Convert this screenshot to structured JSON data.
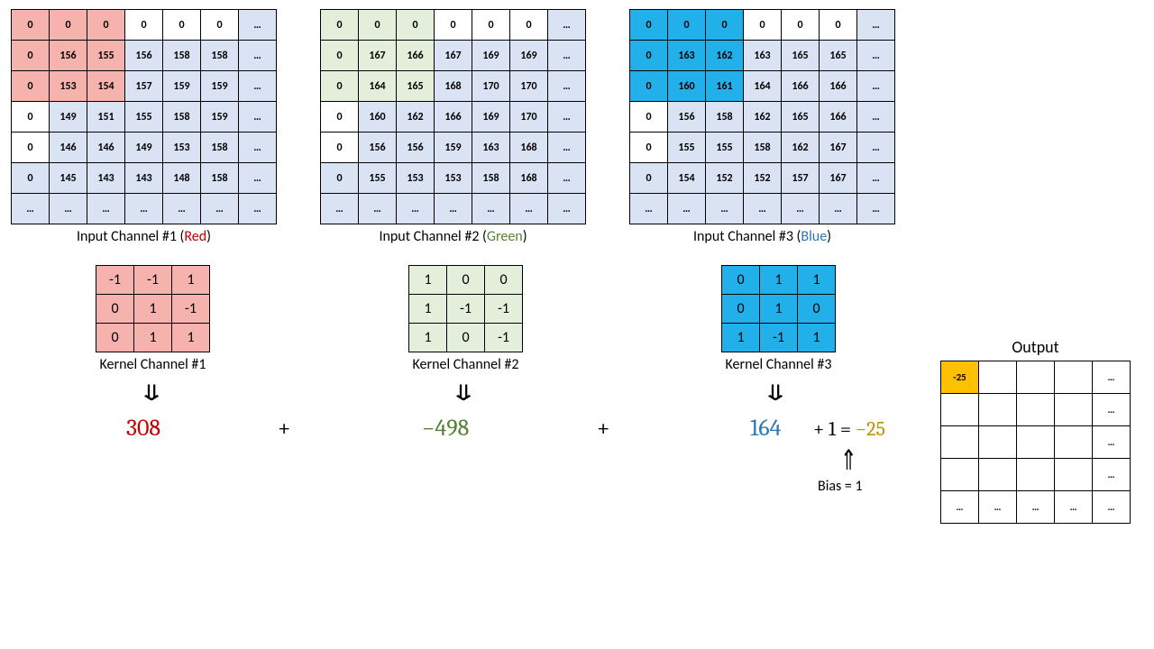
{
  "inputs": [
    {
      "label_pre": "Input Channel #1 (",
      "label_color": "Red",
      "label_post": ")",
      "hl": "r",
      "data": [
        [
          "0",
          "0",
          "0",
          "0",
          "0",
          "0",
          "…"
        ],
        [
          "0",
          "156",
          "155",
          "156",
          "158",
          "158",
          "…"
        ],
        [
          "0",
          "153",
          "154",
          "157",
          "159",
          "159",
          "…"
        ],
        [
          "0",
          "149",
          "151",
          "155",
          "158",
          "159",
          "…"
        ],
        [
          "0",
          "146",
          "146",
          "149",
          "153",
          "158",
          "…"
        ],
        [
          "0",
          "145",
          "143",
          "143",
          "148",
          "158",
          "…"
        ],
        [
          "…",
          "…",
          "…",
          "…",
          "…",
          "…",
          "…"
        ]
      ]
    },
    {
      "label_pre": "Input Channel #2 (",
      "label_color": "Green",
      "label_post": ")",
      "hl": "g",
      "data": [
        [
          "0",
          "0",
          "0",
          "0",
          "0",
          "0",
          "…"
        ],
        [
          "0",
          "167",
          "166",
          "167",
          "169",
          "169",
          "…"
        ],
        [
          "0",
          "164",
          "165",
          "168",
          "170",
          "170",
          "…"
        ],
        [
          "0",
          "160",
          "162",
          "166",
          "169",
          "170",
          "…"
        ],
        [
          "0",
          "156",
          "156",
          "159",
          "163",
          "168",
          "…"
        ],
        [
          "0",
          "155",
          "153",
          "153",
          "158",
          "168",
          "…"
        ],
        [
          "…",
          "…",
          "…",
          "…",
          "…",
          "…",
          "…"
        ]
      ]
    },
    {
      "label_pre": "Input Channel #3 (",
      "label_color": "Blue",
      "label_post": ")",
      "hl": "b",
      "data": [
        [
          "0",
          "0",
          "0",
          "0",
          "0",
          "0",
          "…"
        ],
        [
          "0",
          "163",
          "162",
          "163",
          "165",
          "165",
          "…"
        ],
        [
          "0",
          "160",
          "161",
          "164",
          "166",
          "166",
          "…"
        ],
        [
          "0",
          "156",
          "158",
          "162",
          "165",
          "166",
          "…"
        ],
        [
          "0",
          "155",
          "155",
          "158",
          "162",
          "167",
          "…"
        ],
        [
          "0",
          "154",
          "152",
          "152",
          "157",
          "167",
          "…"
        ],
        [
          "…",
          "…",
          "…",
          "…",
          "…",
          "…",
          "…"
        ]
      ]
    }
  ],
  "kernels": [
    {
      "label": "Kernel Channel #1",
      "hl": "r",
      "data": [
        [
          "-1",
          "-1",
          "1"
        ],
        [
          "0",
          "1",
          "-1"
        ],
        [
          "0",
          "1",
          "1"
        ]
      ]
    },
    {
      "label": "Kernel Channel #2",
      "hl": "g",
      "data": [
        [
          "1",
          "0",
          "0"
        ],
        [
          "1",
          "-1",
          "-1"
        ],
        [
          "1",
          "0",
          "-1"
        ]
      ]
    },
    {
      "label": "Kernel Channel #3",
      "hl": "b",
      "data": [
        [
          "0",
          "1",
          "1"
        ],
        [
          "0",
          "1",
          "0"
        ],
        [
          "1",
          "-1",
          "1"
        ]
      ]
    }
  ],
  "calc": {
    "v1": "308",
    "v2": "−498",
    "v3": "164",
    "bias_expr": "+ 1 =",
    "result": "−25",
    "bias_label": "Bias = 1"
  },
  "output": {
    "title": "Output",
    "data": [
      [
        "-25",
        "",
        "",
        "",
        "…"
      ],
      [
        "",
        "",
        "",
        "",
        "…"
      ],
      [
        "",
        "",
        "",
        "",
        "…"
      ],
      [
        "",
        "",
        "",
        "",
        "…"
      ],
      [
        "…",
        "…",
        "…",
        "…",
        "…"
      ]
    ]
  }
}
